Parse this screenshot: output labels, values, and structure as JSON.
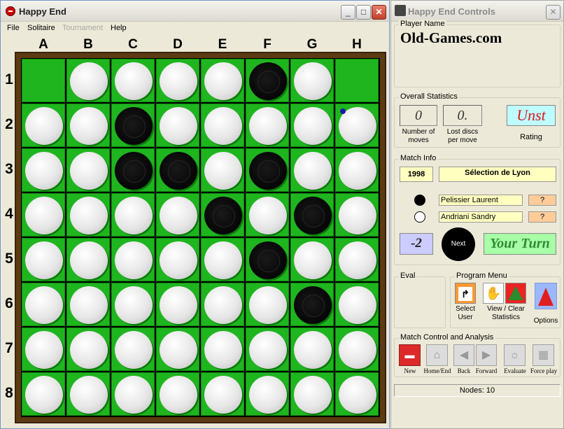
{
  "main_window": {
    "title": "Happy End",
    "menu": [
      {
        "label": "File",
        "enabled": true
      },
      {
        "label": "Solitaire",
        "enabled": true
      },
      {
        "label": "Tournament",
        "enabled": false
      },
      {
        "label": "Help",
        "enabled": true
      }
    ],
    "window_buttons": {
      "minimize": "_",
      "maximize": "□",
      "close": "✕"
    }
  },
  "board": {
    "columns": [
      "A",
      "B",
      "C",
      "D",
      "E",
      "F",
      "G",
      "H"
    ],
    "rows": [
      "1",
      "2",
      "3",
      "4",
      "5",
      "6",
      "7",
      "8"
    ],
    "cells": [
      [
        "empty",
        "white",
        "white",
        "white",
        "white",
        "black",
        "white",
        "empty"
      ],
      [
        "white",
        "white",
        "black",
        "white",
        "white",
        "white",
        "white",
        "white"
      ],
      [
        "white",
        "white",
        "black",
        "black",
        "white",
        "black",
        "white",
        "white"
      ],
      [
        "white",
        "white",
        "white",
        "white",
        "black",
        "white",
        "black",
        "white"
      ],
      [
        "white",
        "white",
        "white",
        "white",
        "white",
        "black",
        "white",
        "white"
      ],
      [
        "white",
        "white",
        "white",
        "white",
        "white",
        "white",
        "black",
        "white"
      ],
      [
        "white",
        "white",
        "white",
        "white",
        "white",
        "white",
        "white",
        "white"
      ],
      [
        "white",
        "white",
        "white",
        "white",
        "white",
        "white",
        "white",
        "white"
      ]
    ],
    "last_move_marker": "H2",
    "colors": {
      "green": "#1fb51f",
      "frame": "#5c3a12"
    }
  },
  "controls_window": {
    "title": "Happy End Controls",
    "player_name": {
      "legend": "Player Name",
      "value": "Old-Games.com"
    },
    "overall_statistics": {
      "legend": "Overall Statistics",
      "moves_value": "0",
      "moves_label_1": "Number of",
      "moves_label_2": "moves",
      "lost_value": "0.",
      "lost_label_1": "Lost discs",
      "lost_label_2": "per move",
      "rating_value": "Unst",
      "rating_label": "Rating"
    },
    "match_info": {
      "legend": "Match Info",
      "year": "1998",
      "event": "Sélection de Lyon",
      "black_player": "Pelissier Laurent",
      "black_score": "?",
      "white_player": "Andriani Sandry",
      "white_score": "?",
      "disc_diff": "-2",
      "next_label": "Next",
      "turn_text": "Your Turn"
    },
    "eval": {
      "legend": "Eval"
    },
    "program_menu": {
      "legend": "Program Menu",
      "select_user_1": "Select",
      "select_user_2": "User",
      "view_clear_1": "View / Clear",
      "view_clear_2": "Statistics",
      "options": "Options"
    },
    "match_control": {
      "legend": "Match Control and Analysis",
      "buttons": [
        "New",
        "Home/End",
        "Back",
        "Forward",
        "Evaluate",
        "Force play"
      ]
    },
    "status": "Nodes: 10"
  }
}
